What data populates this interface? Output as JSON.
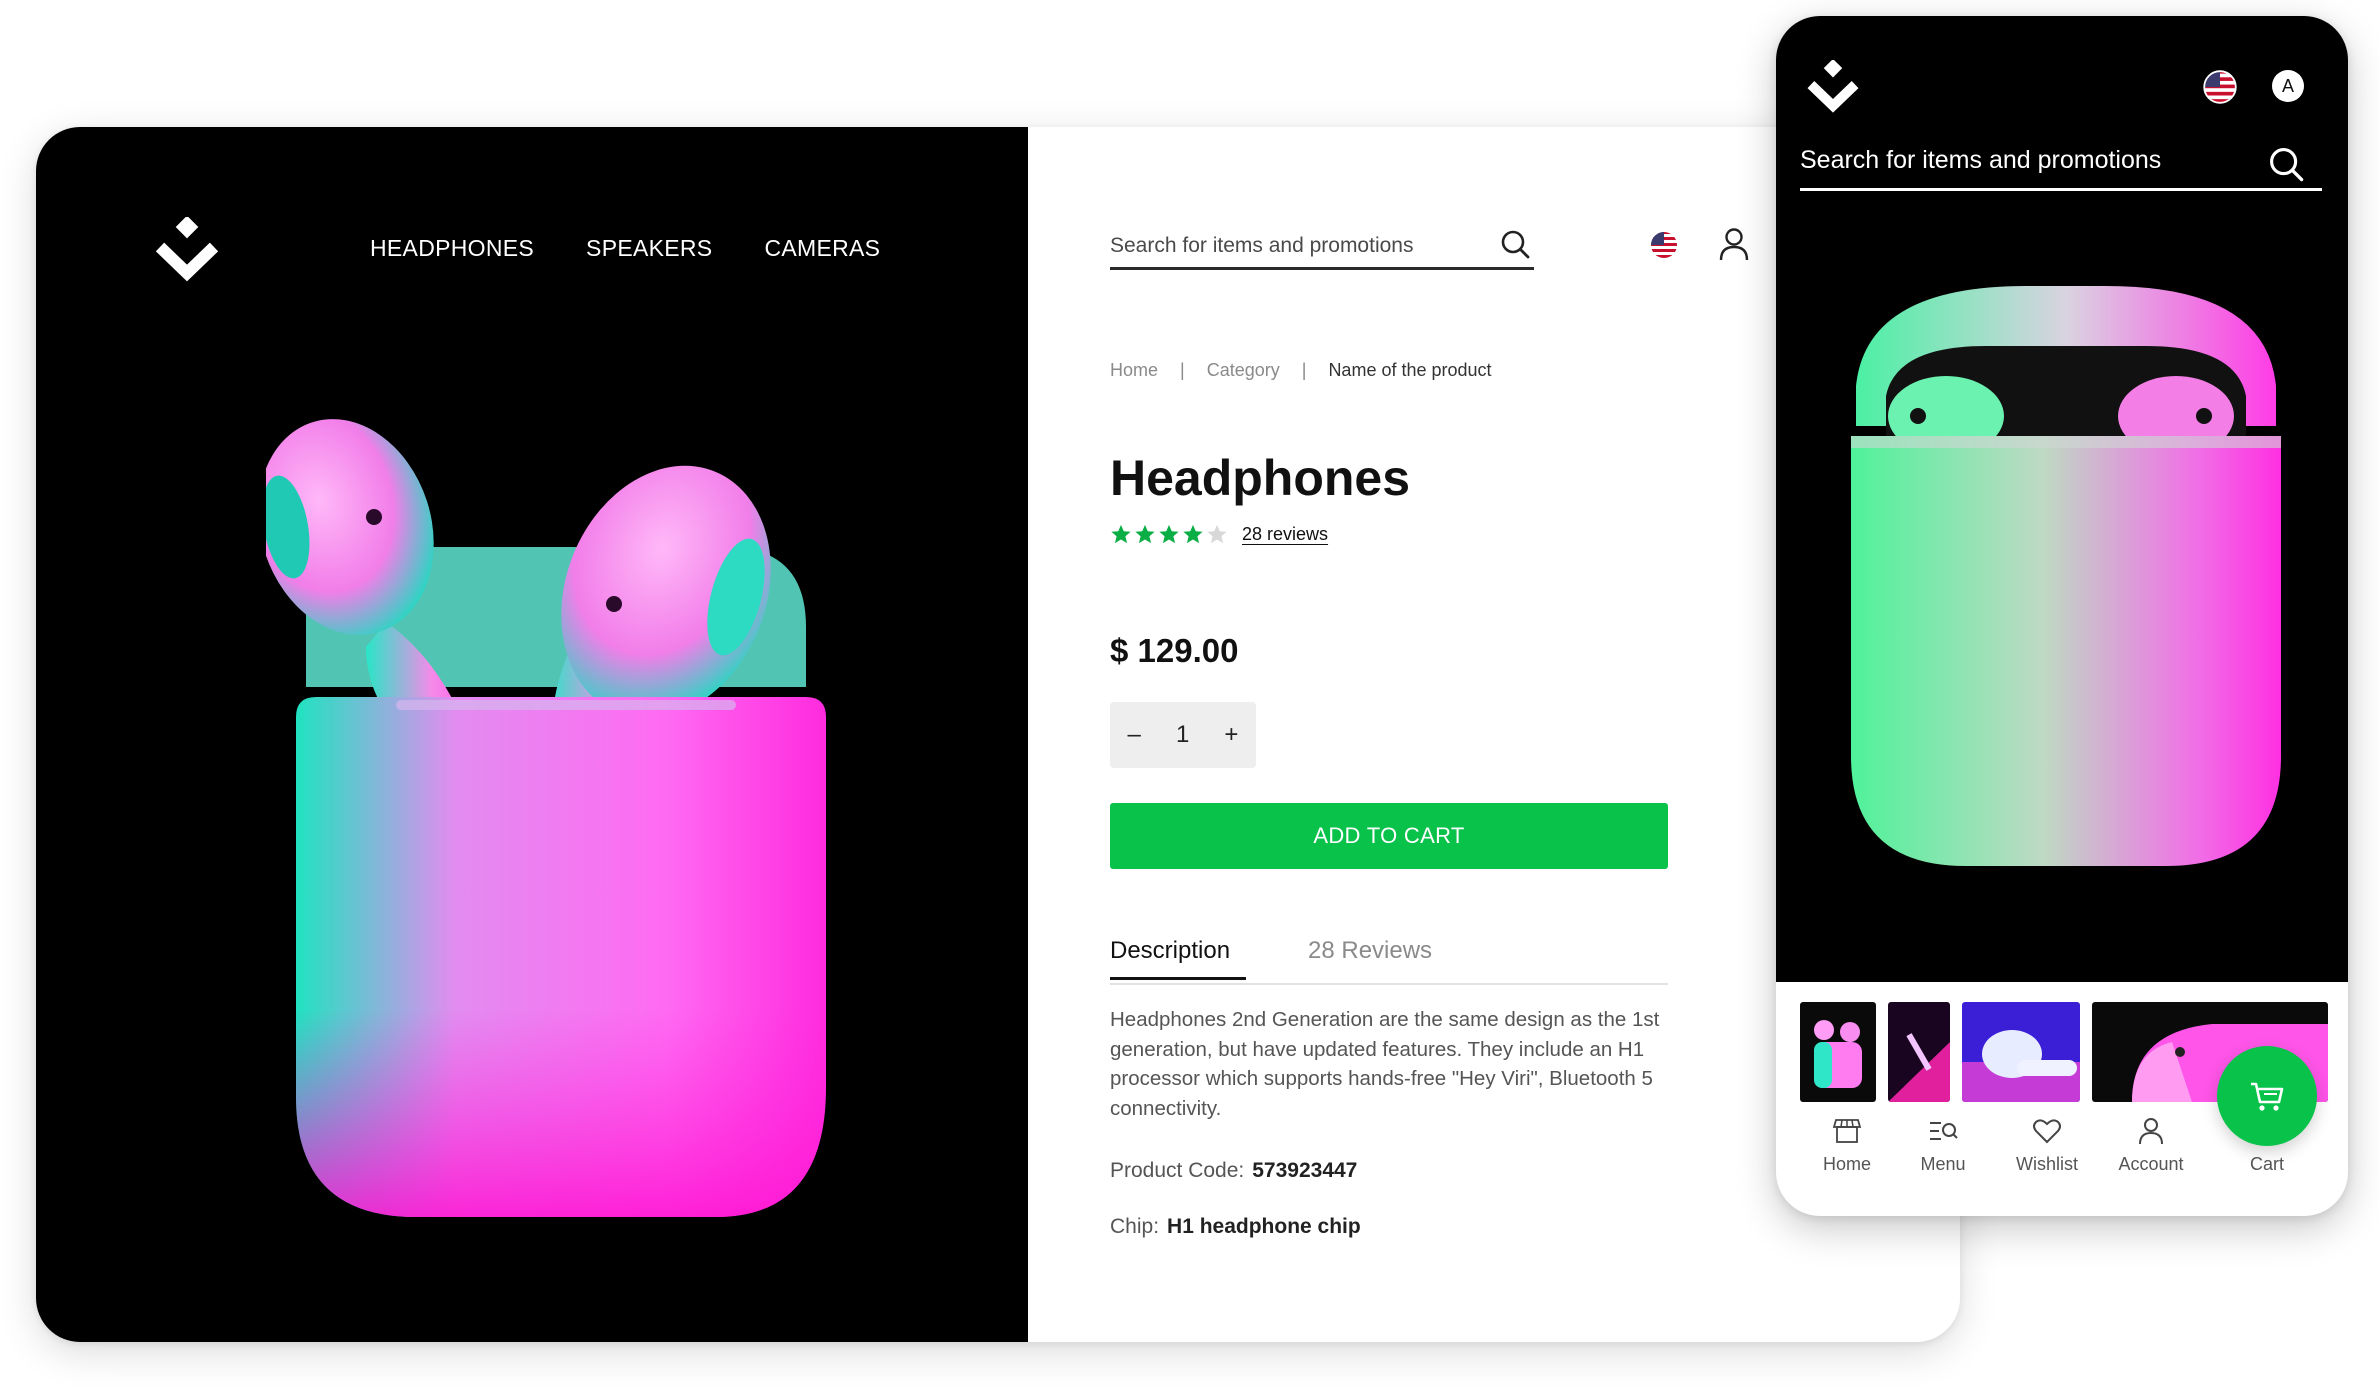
{
  "desktop": {
    "nav": {
      "items": [
        "HEADPHONES",
        "SPEAKERS",
        "CAMERAS"
      ]
    },
    "search": {
      "placeholder": "Search for items and promotions"
    },
    "breadcrumb": {
      "home": "Home",
      "separator": "|",
      "category": "Category",
      "current": "Name of the product"
    },
    "product": {
      "title": "Headphones",
      "rating": 4,
      "rating_max": 5,
      "reviews_link": "28 reviews",
      "price": "$ 129.00",
      "quantity": "1",
      "minus": "–",
      "plus": "+",
      "add_to_cart": "ADD TO CART"
    },
    "tabs": {
      "description": "Description",
      "reviews": "28 Reviews"
    },
    "description": "Headphones 2nd Generation are the same design as the 1st generation, but have updated features. They include an H1 processor which supports hands-free \"Hey Viri\", Bluetooth 5 connectivity.",
    "specs": [
      {
        "label": "Product Code:",
        "value": "573923447"
      },
      {
        "label": "Chip:",
        "value": "H1 headphone chip"
      }
    ]
  },
  "mobile": {
    "search": {
      "placeholder": "Search for items and promotions"
    },
    "avatar_letter": "A",
    "bottom_nav": {
      "home": "Home",
      "menu": "Menu",
      "wishlist": "Wishlist",
      "account": "Account",
      "cart": "Cart"
    }
  },
  "colors": {
    "accent_green": "#08c24a",
    "dark": "#000000",
    "neon_pink": "#ff3df0",
    "neon_teal": "#19e6c4"
  },
  "icons": [
    "logo-icon",
    "search-icon",
    "flag-us-icon",
    "user-icon",
    "star-icon",
    "home-store-icon",
    "menu-search-icon",
    "heart-icon",
    "account-icon",
    "cart-icon"
  ]
}
